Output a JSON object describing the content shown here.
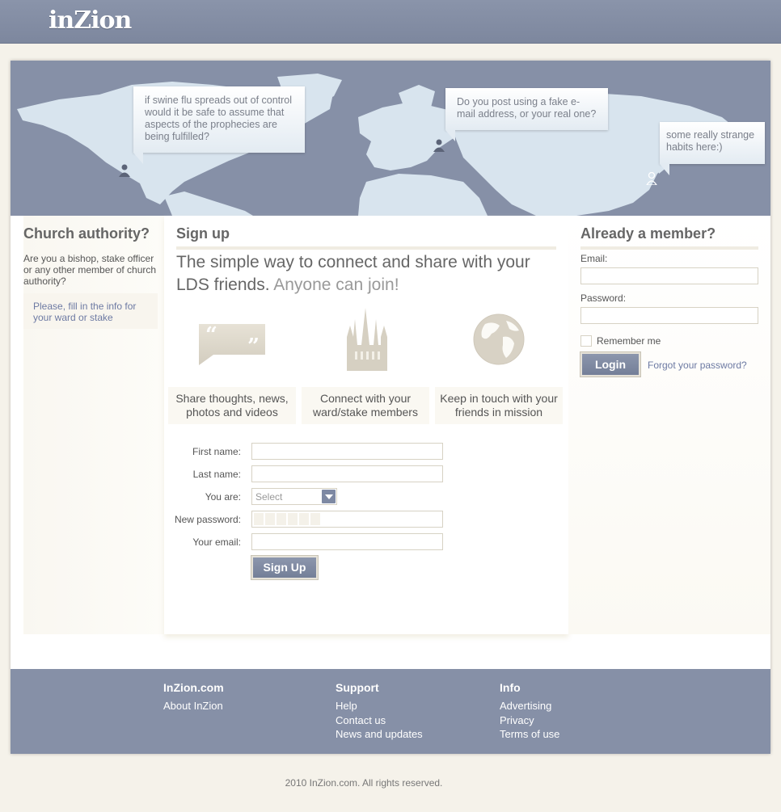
{
  "header": {
    "logo": "inZion"
  },
  "hero": {
    "bubbles": [
      {
        "text": "if swine flu spreads out of control would it be safe to assume that aspects of the prophecies are being fulfilled?"
      },
      {
        "text": "Do you post using a fake e-mail address, or your real one?"
      },
      {
        "text": "some really strange habits here:)"
      }
    ]
  },
  "church_authority": {
    "title": "Church authority?",
    "text": "Are you a bishop, stake officer or any other member of church authority?",
    "link": "Please, fill in the info for your ward or stake"
  },
  "signup": {
    "title": "Sign up",
    "tagline_main": "The simple way to connect and share with your LDS friends.",
    "tagline_soft": "Anyone can join!",
    "features": [
      {
        "icon": "speech-bubble-icon",
        "caption": "Share thoughts, news, photos and videos"
      },
      {
        "icon": "temple-icon",
        "caption": "Connect with your ward/stake members"
      },
      {
        "icon": "globe-icon",
        "caption": "Keep in touch with your friends in mission"
      }
    ],
    "form": {
      "first_name_label": "First name:",
      "last_name_label": "Last name:",
      "you_are_label": "You are:",
      "you_are_value": "Select",
      "new_password_label": "New password:",
      "email_label": "Your email:",
      "submit": "Sign Up"
    }
  },
  "login": {
    "title": "Already a member?",
    "email_label": "Email:",
    "password_label": "Password:",
    "remember": "Remember me",
    "submit": "Login",
    "forgot": "Forgot your password?"
  },
  "footer": {
    "columns": [
      {
        "heading": "InZion.com",
        "links": [
          "About InZion"
        ]
      },
      {
        "heading": "Support",
        "links": [
          "Help",
          "Contact us",
          "News and updates"
        ]
      },
      {
        "heading": "Info",
        "links": [
          "Advertising",
          "Privacy",
          "Terms of use"
        ]
      }
    ],
    "copyright": "2010 InZion.com. All rights reserved."
  },
  "colors": {
    "accent": "#8690a7",
    "background": "#f5f2ea",
    "link": "#6d7aa3"
  }
}
